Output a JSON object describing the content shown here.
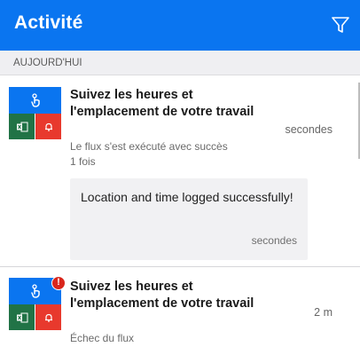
{
  "app_bar": {
    "title": "Activité",
    "filter_icon": "filter-icon",
    "background_color": "#0a75f0"
  },
  "section": {
    "label": "AUJOURD'HUI"
  },
  "activities": [
    {
      "title": "Suivez les heures et l'emplacement de votre travail",
      "time": "secondes",
      "status": "Le flux s'est exécuté avec succès",
      "run_count": "1 fois",
      "has_error": false,
      "icons": [
        "touch-icon",
        "excel-icon",
        "notification-icon"
      ],
      "message": {
        "text": "Location and time logged successfully!",
        "time": "secondes"
      }
    },
    {
      "title": "Suivez les heures et l'emplacement de votre travail",
      "time": "2 m",
      "status": "Échec du flux",
      "has_error": true,
      "error_badge": "!",
      "icons": [
        "touch-icon",
        "excel-icon",
        "notification-icon"
      ]
    }
  ],
  "colors": {
    "accent": "#0a75f0",
    "excel": "#217346",
    "notification": "#e8392d",
    "error": "#d9261c"
  }
}
